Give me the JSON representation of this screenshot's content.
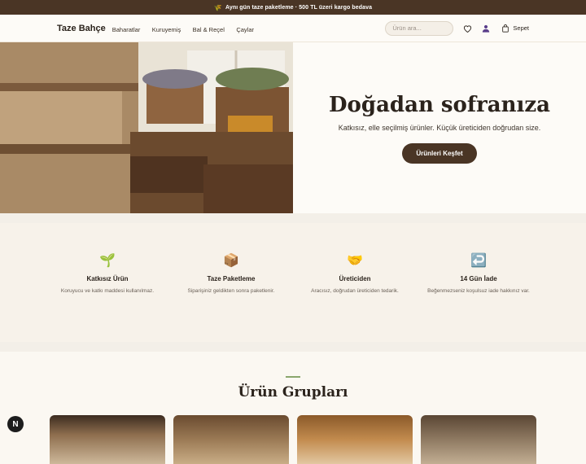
{
  "topbar": {
    "icon": "sprout-icon",
    "text": "Aynı gün taze paketleme · 500 TL üzeri kargo bedava"
  },
  "header": {
    "logo": "Taze Bahçe",
    "nav": [
      "Baharatlar",
      "Kuruyemiş",
      "Bal & Reçel",
      "Çaylar"
    ],
    "search_placeholder": "Ürün ara...",
    "cart_label": "Sepet"
  },
  "hero": {
    "title": "Doğadan sofranıza",
    "subtitle": "Katkısız, elle seçilmiş ürünler. Küçük üreticiden doğrudan size.",
    "button": "Ürünleri Keşfet"
  },
  "features": [
    {
      "icon": "seedling-icon",
      "title": "Katkısız Ürün",
      "desc": "Koruyucu ve katkı maddesi kullanılmaz."
    },
    {
      "icon": "package-icon",
      "title": "Taze Paketleme",
      "desc": "Siparişiniz geldikten sonra paketlenir."
    },
    {
      "icon": "handshake-icon",
      "title": "Üreticiden",
      "desc": "Aracısız, doğrudan üreticiden tedarik."
    },
    {
      "icon": "return-arrow-icon",
      "title": "14 Gün İade",
      "desc": "Beğenmezseniz koşulsuz iade hakkınız var."
    }
  ],
  "section": {
    "title": "Ürün Grupları"
  },
  "badge": "N"
}
